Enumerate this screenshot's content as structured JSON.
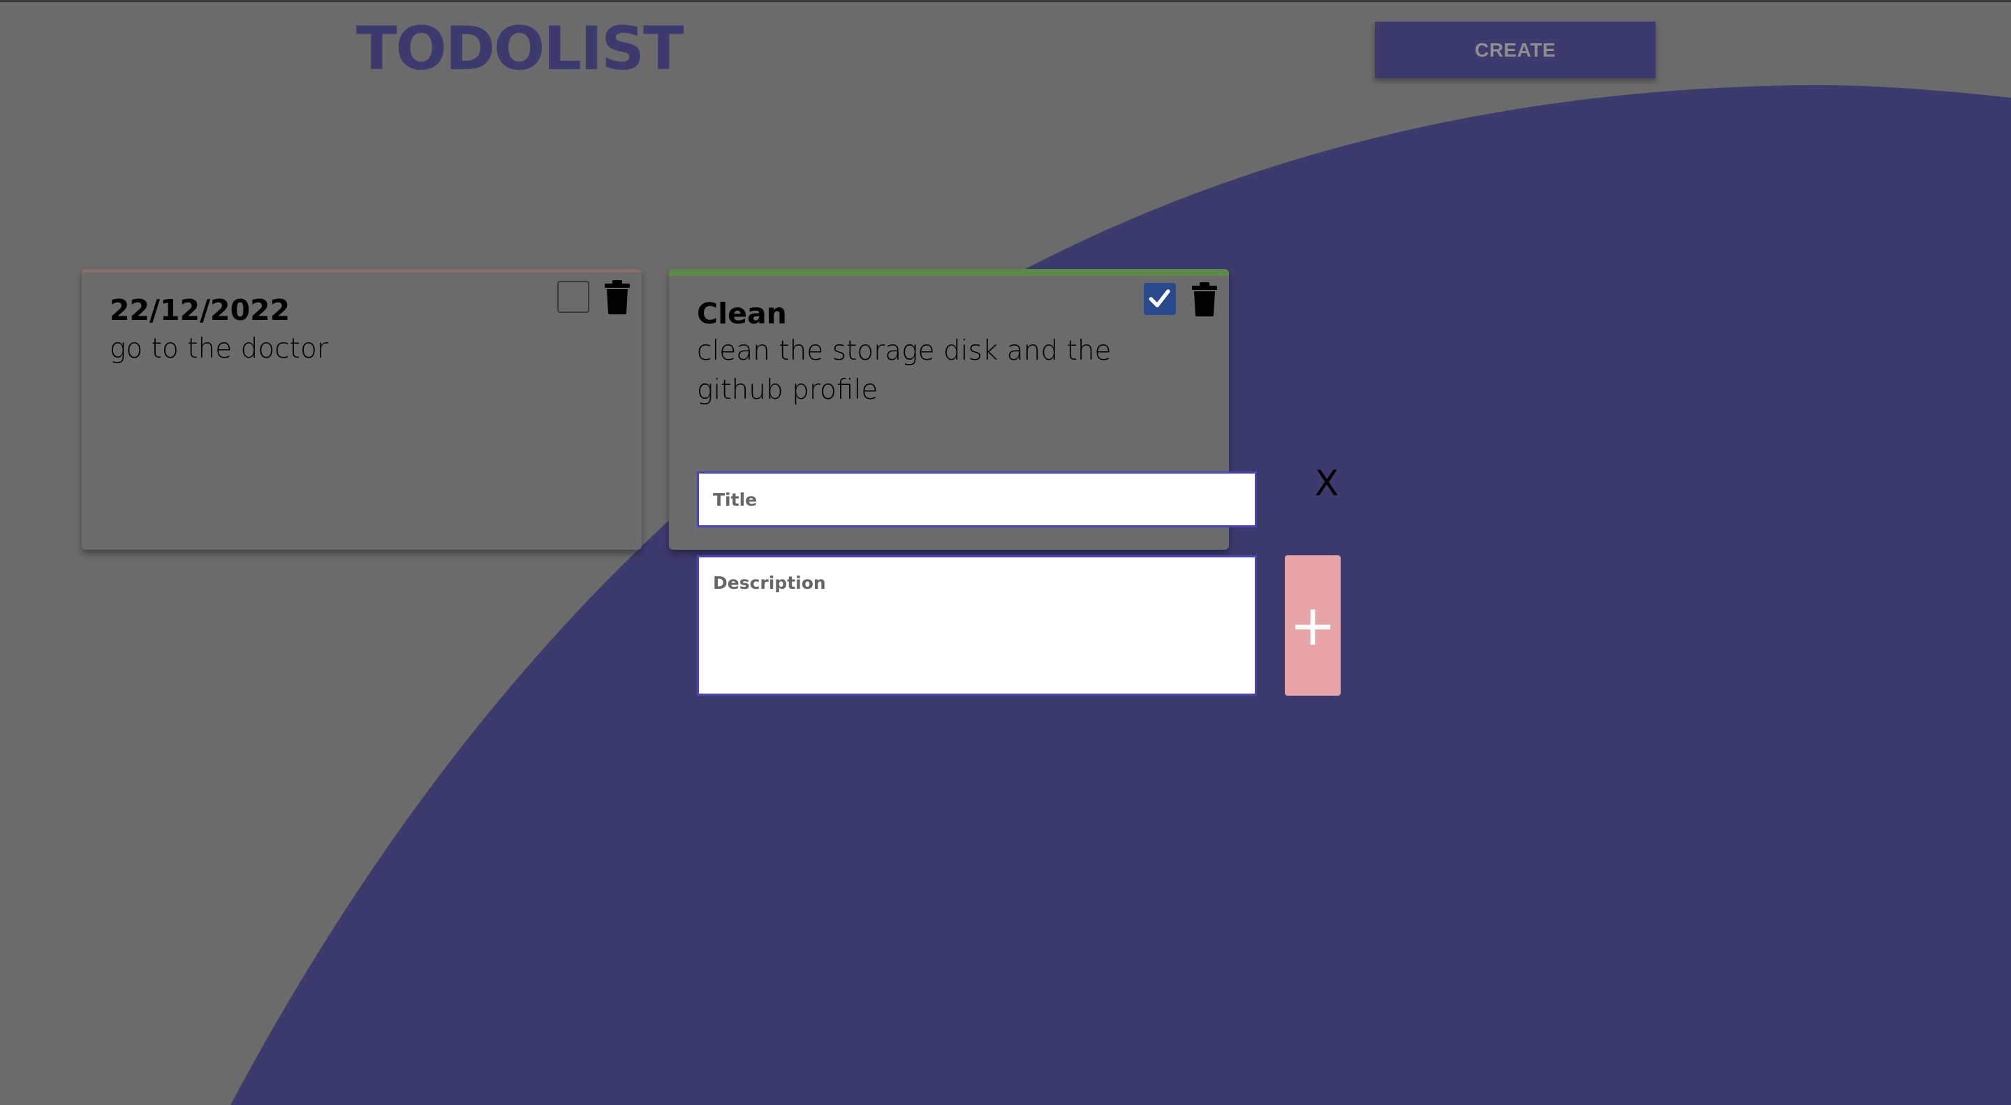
{
  "header": {
    "title": "TODOLIST",
    "create_label": "CREATE"
  },
  "todos": [
    {
      "title": "22/12/2022",
      "description": "go to the doctor",
      "done": false,
      "accent": "#8a6c6c"
    },
    {
      "title": "Clean",
      "description": "clean the storage disk and the github profile",
      "done": true,
      "accent": "#5b8a4a"
    }
  ],
  "form": {
    "title_placeholder": "Title",
    "description_placeholder": "Description",
    "close_label": "X",
    "add_label": "+"
  },
  "colors": {
    "background": "#6b6b6b",
    "blob": "#3d3a6e",
    "accent": "#3d3a6e",
    "add_button": "#e8a5a8",
    "checkbox_checked": "#284a8c"
  }
}
